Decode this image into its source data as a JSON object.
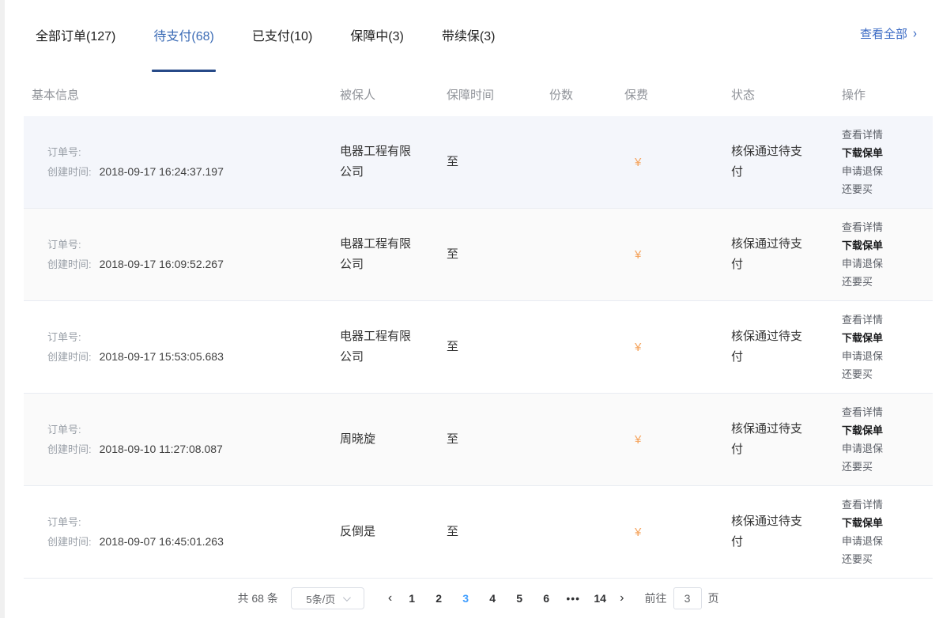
{
  "tabs": [
    {
      "label": "全部订单(127)",
      "active": false
    },
    {
      "label": "待支付(68)",
      "active": true
    },
    {
      "label": "已支付(10)",
      "active": false
    },
    {
      "label": "保障中(3)",
      "active": false
    },
    {
      "label": "带续保(3)",
      "active": false
    }
  ],
  "view_all": {
    "label": "查看全部",
    "chevron": "›"
  },
  "table": {
    "headers": [
      "基本信息",
      "被保人",
      "保障时间",
      "份数",
      "保费",
      "状态",
      "操作"
    ],
    "row_labels": {
      "order_no": "订单号:",
      "created": "创建时间:"
    },
    "rows": [
      {
        "order_no": "",
        "created": "2018-09-17 16:24:37.197",
        "insured": "电器工程有限公司",
        "period": "至",
        "copies": "",
        "premium": "¥",
        "status": "核保通过待支付",
        "actions": [
          "查看详情",
          "下载保单",
          "申请退保",
          "还要买"
        ]
      },
      {
        "order_no": "",
        "created": "2018-09-17 16:09:52.267",
        "insured": "电器工程有限公司",
        "period": "至",
        "copies": "",
        "premium": "¥",
        "status": "核保通过待支付",
        "actions": [
          "查看详情",
          "下载保单",
          "申请退保",
          "还要买"
        ]
      },
      {
        "order_no": "",
        "created": "2018-09-17 15:53:05.683",
        "insured": "电器工程有限公司",
        "period": "至",
        "copies": "",
        "premium": "¥",
        "status": "核保通过待支付",
        "actions": [
          "查看详情",
          "下载保单",
          "申请退保",
          "还要买"
        ]
      },
      {
        "order_no": "",
        "created": "2018-09-10 11:27:08.087",
        "insured": "周晓旋",
        "period": "至",
        "copies": "",
        "premium": "¥",
        "status": "核保通过待支付",
        "actions": [
          "查看详情",
          "下载保单",
          "申请退保",
          "还要买"
        ]
      },
      {
        "order_no": "",
        "created": "2018-09-07 16:45:01.263",
        "insured": "反倒是",
        "period": "至",
        "copies": "",
        "premium": "¥",
        "status": "核保通过待支付",
        "actions": [
          "查看详情",
          "下载保单",
          "申请退保",
          "还要买"
        ]
      }
    ]
  },
  "pagination": {
    "total": "共 68 条",
    "page_size": "5条/页",
    "prev": "‹",
    "next": "›",
    "pages": [
      "1",
      "2",
      "3",
      "4",
      "5",
      "6",
      "•••",
      "14"
    ],
    "active_page": "3",
    "goto_label": "前往",
    "goto_value": "3",
    "page_suffix": "页"
  },
  "colors": {
    "active_tab_text": "#3b6bb5",
    "active_tab_underline": "#274a88",
    "link_blue": "#3a6ac4",
    "active_page_blue": "#409eff",
    "premium_orange": "#f5a35c",
    "header_grey": "#909399",
    "stripe_bg": "#fafafa",
    "hover_row_bg": "#f4f6fb"
  }
}
